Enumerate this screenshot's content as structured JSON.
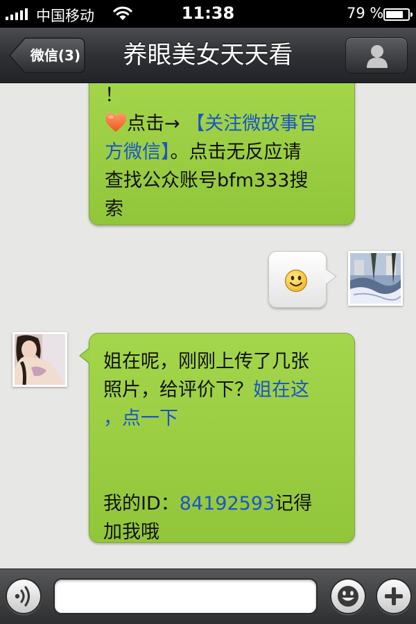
{
  "status_bar": {
    "carrier": "中国移动",
    "time": "11:38",
    "battery_percent": "79 %",
    "battery_level": 0.79,
    "signal_icon": "signal-bars-icon",
    "wifi_icon": "wifi-icon",
    "battery_icon": "battery-icon"
  },
  "nav": {
    "back_label": "微信(3)",
    "title": "养眼美女天天看",
    "profile_icon": "person-icon"
  },
  "messages": [
    {
      "sender": "other",
      "lines": [
        "！",
        "点击→",
        "【关注微故事官",
        "方微信】",
        "。点击无反应请",
        "查找公众账号bfm333搜",
        "索"
      ],
      "icon": "heart-icon"
    },
    {
      "sender": "self",
      "content": "smiley-emoji",
      "icon": "smiley-icon"
    },
    {
      "sender": "other",
      "line1": "姐在呢，刚刚上传了几张",
      "line2_text": "照片，给评价下？",
      "line2_link": "姐在这",
      "line3_link": "，点一下",
      "id_label": "我的ID：",
      "id_value": "84192593",
      "id_suffix": "记得",
      "last_line": "加我哦"
    }
  ],
  "input_bar": {
    "voice_icon": "voice-icon",
    "input_value": "",
    "emoji_icon": "smiley-face-icon",
    "plus_icon": "plus-icon"
  },
  "colors": {
    "bubble_green": "#9fd045",
    "link_blue": "#1a55c8",
    "chat_background": "#e7e7e5",
    "nav_dark": "#2f3134"
  }
}
